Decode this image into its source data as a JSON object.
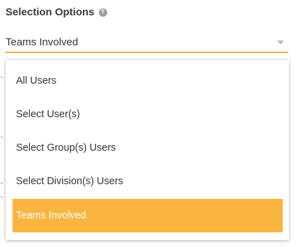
{
  "section": {
    "title": "Selection Options",
    "help_icon": "question-circle-icon"
  },
  "select": {
    "value": "Teams Involved",
    "caret_icon": "caret-down-icon",
    "accent_color": "#f5b041"
  },
  "dropdown": {
    "options": [
      {
        "label": "All Users",
        "selected": false
      },
      {
        "label": "Select User(s)",
        "selected": false
      },
      {
        "label": "Select Group(s) Users",
        "selected": false
      },
      {
        "label": "Select Division(s) Users",
        "selected": false
      },
      {
        "label": "Teams Involved",
        "selected": true
      }
    ],
    "selected_color": "#f9b53f"
  }
}
